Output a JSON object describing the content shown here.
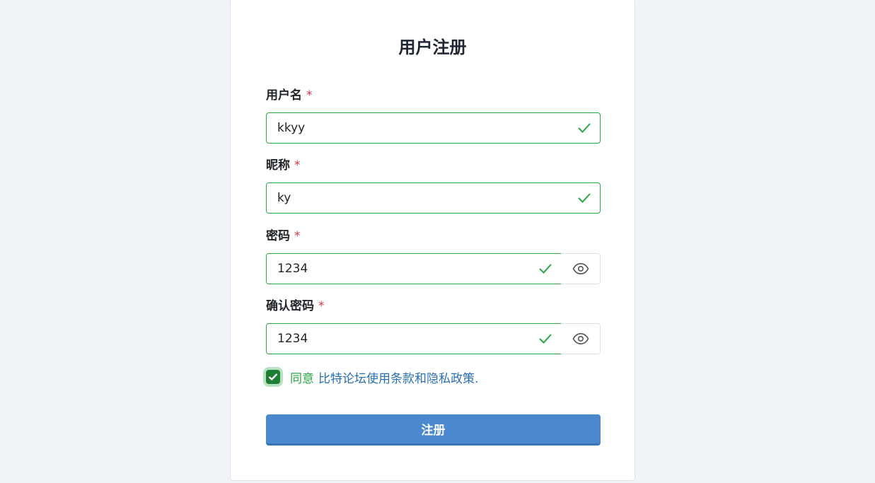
{
  "page": {
    "title": "用户注册"
  },
  "form": {
    "username": {
      "label": "用户名",
      "required_mark": "*",
      "value": "kkyy"
    },
    "nickname": {
      "label": "昵称",
      "required_mark": "*",
      "value": "ky"
    },
    "password": {
      "label": "密码",
      "required_mark": "*",
      "value": "1234"
    },
    "confirm_password": {
      "label": "确认密码",
      "required_mark": "*",
      "value": "1234"
    },
    "agreement": {
      "checked": true,
      "text": "同意",
      "link_text": "比特论坛使用条款和隐私政策."
    },
    "submit_label": "注册"
  },
  "colors": {
    "background": "#f0f3f8",
    "valid_border": "#28a745",
    "required": "#dc3545",
    "link": "#2a6fb5",
    "primary_button": "#4a89d0"
  },
  "icons": {
    "valid": "check-icon",
    "toggle_visibility": "eye-icon",
    "checkbox": "checkbox-checked-icon"
  }
}
